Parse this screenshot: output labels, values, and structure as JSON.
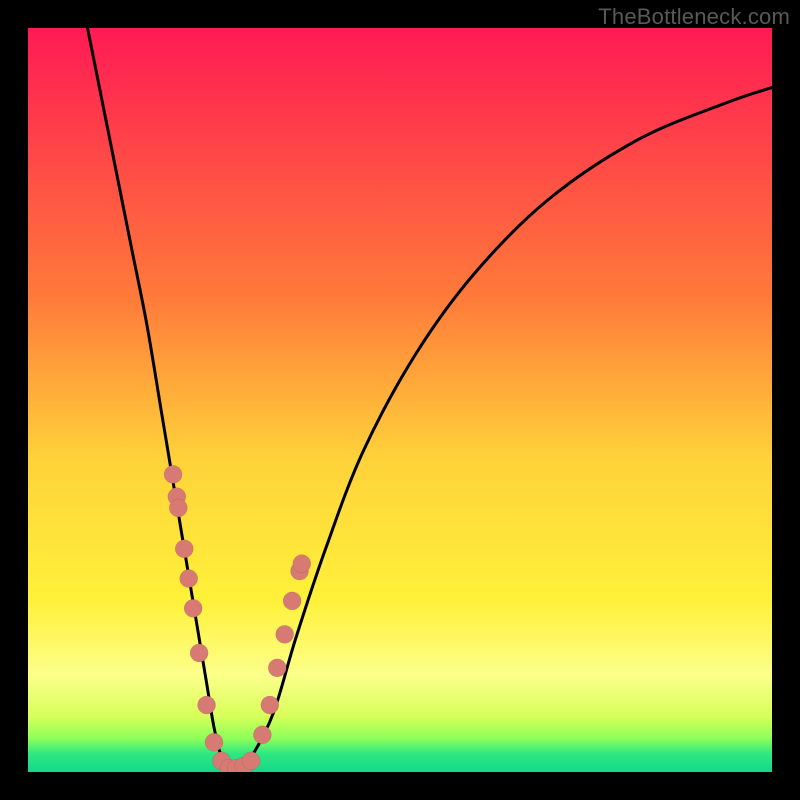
{
  "watermark": "TheBottleneck.com",
  "chart_data": {
    "type": "line",
    "title": "",
    "xlabel": "",
    "ylabel": "",
    "xlim": [
      0,
      100
    ],
    "ylim": [
      0,
      100
    ],
    "background_gradient_stops": [
      {
        "offset": 0.0,
        "color": "#ff1a54"
      },
      {
        "offset": 0.36,
        "color": "#ff7a3a"
      },
      {
        "offset": 0.58,
        "color": "#ffd23a"
      },
      {
        "offset": 0.77,
        "color": "#fff13a"
      },
      {
        "offset": 0.87,
        "color": "#fcff8a"
      },
      {
        "offset": 0.925,
        "color": "#d8ff5a"
      },
      {
        "offset": 0.955,
        "color": "#8cff5a"
      },
      {
        "offset": 0.975,
        "color": "#30e880"
      },
      {
        "offset": 1.0,
        "color": "#12d88a"
      }
    ],
    "series": [
      {
        "name": "curve",
        "x": [
          8,
          10,
          12,
          14,
          16,
          18,
          20,
          21,
          22,
          23,
          24,
          25,
          26,
          27,
          28,
          30,
          33,
          36,
          40,
          45,
          52,
          60,
          70,
          82,
          94,
          100
        ],
        "y": [
          100,
          90,
          80,
          70,
          60,
          48,
          36,
          30,
          24,
          18,
          12,
          6,
          2,
          0,
          0,
          2,
          8,
          18,
          30,
          43,
          56,
          67,
          77,
          85,
          90,
          92
        ]
      }
    ],
    "scatter": [
      {
        "name": "dots",
        "x": [
          19.5,
          20.0,
          20.2,
          21.0,
          21.6,
          22.2,
          23.0,
          24.0,
          25.0,
          26.0,
          27.0,
          28.0,
          29.0,
          30.0,
          31.5,
          32.5,
          33.5,
          34.5,
          35.5,
          36.5,
          36.8
        ],
        "y": [
          40.0,
          37.0,
          35.5,
          30.0,
          26.0,
          22.0,
          16.0,
          9.0,
          4.0,
          1.5,
          0.5,
          0.5,
          0.8,
          1.5,
          5.0,
          9.0,
          14.0,
          18.5,
          23.0,
          27.0,
          28.0
        ],
        "r": 9
      }
    ]
  }
}
